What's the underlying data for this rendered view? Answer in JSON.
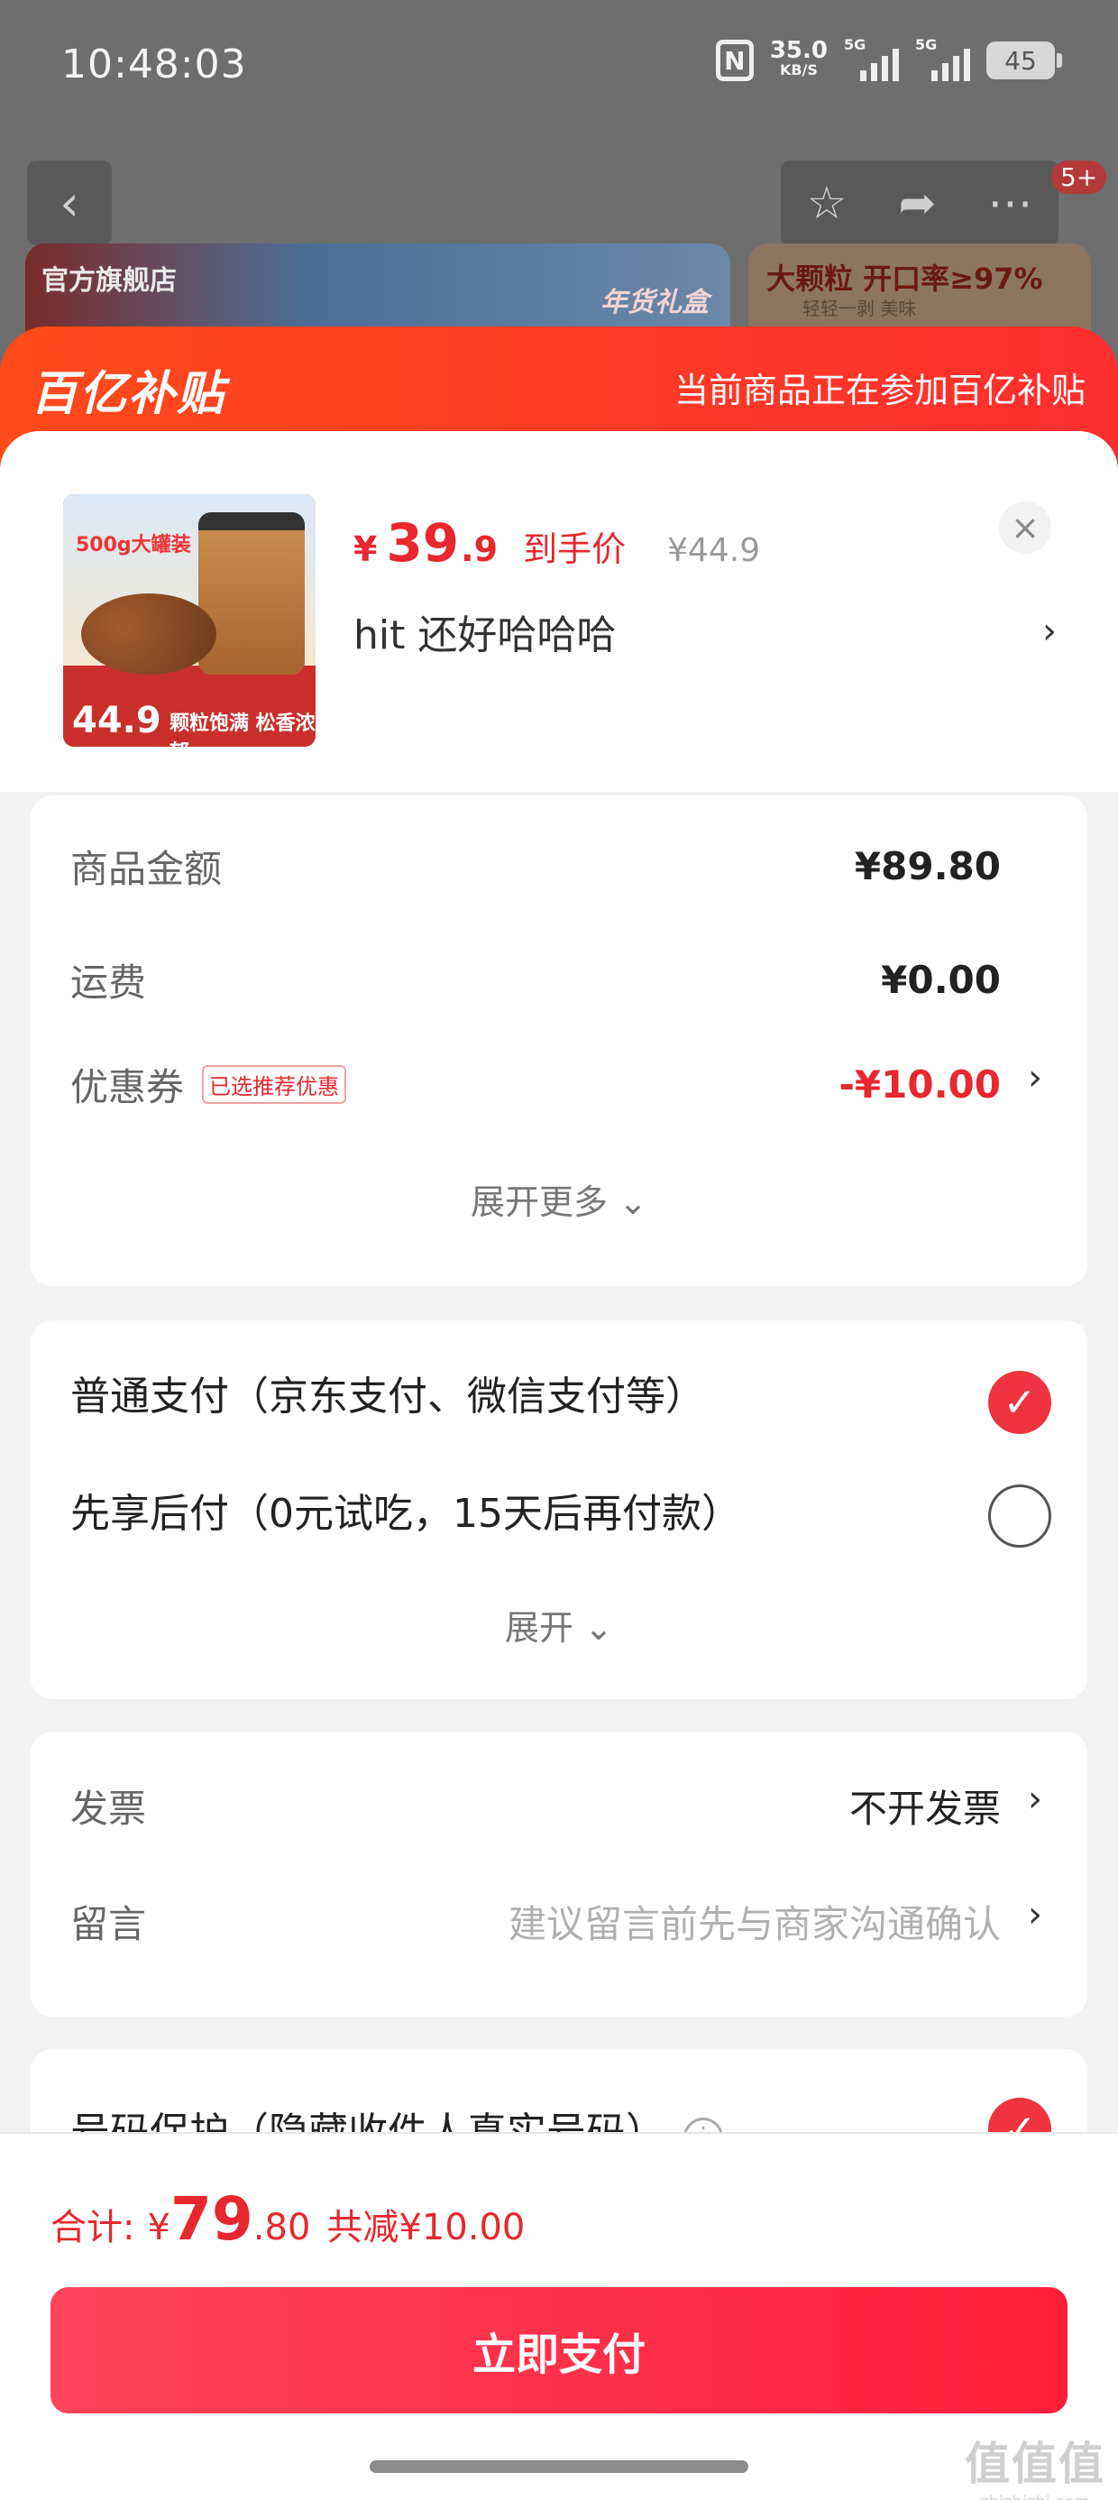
{
  "status_bar": {
    "time": "10:48:03",
    "speed_value": "35.0",
    "speed_unit": "KB/S",
    "sim1_label": "5G",
    "sim2_label": "5G",
    "battery": "45"
  },
  "background": {
    "badge_count": "5+",
    "shop_banner": "官方旗舰店",
    "banner_tag": "年货礼盒",
    "side_banner": "大颗粒 开口率≥97%",
    "side_banner_sub": "轻轻一剥 美味"
  },
  "header": {
    "brand": "百亿补贴",
    "note": "当前商品正在参加百亿补贴"
  },
  "product": {
    "thumb_label": "500g大罐装",
    "thumb_price": "44.9",
    "thumb_slogan": "颗粒饱满 松香浓郁",
    "price_currency": "¥",
    "price_int": "39",
    "price_dec": ".9",
    "price_label": "到手价",
    "original_price": "¥44.9",
    "spec": "hit  还好哈哈哈"
  },
  "summary": {
    "goods_label": "商品金额",
    "goods_value": "¥89.80",
    "shipping_label": "运费",
    "shipping_value": "¥0.00",
    "coupon_label": "优惠券",
    "coupon_tag": "已选推荐优惠",
    "coupon_value": "-¥10.00",
    "expand_more": "展开更多"
  },
  "payment": {
    "option1": "普通支付（京东支付、微信支付等）",
    "option2": "先享后付（0元试吃，15天后再付款）",
    "expand": "展开",
    "selected_index": 0
  },
  "extras": {
    "invoice_label": "发票",
    "invoice_value": "不开发票",
    "message_label": "留言",
    "message_placeholder": "建议留言前先与商家沟通确认"
  },
  "privacy": {
    "label": "号码保护（隐藏收件人真实号码）"
  },
  "footer": {
    "total_label": "合计:",
    "total_currency": "¥",
    "total_int": "79",
    "total_dec": ".80",
    "total_saving": "共减¥10.00",
    "pay_button": "立即支付",
    "watermark": "值值值",
    "watermark_url": "zhizhizhi.com"
  },
  "colors": {
    "accent_red": "#e8272e",
    "header_orange": "#ff4a1a",
    "pay_button": "#ff2e45"
  }
}
